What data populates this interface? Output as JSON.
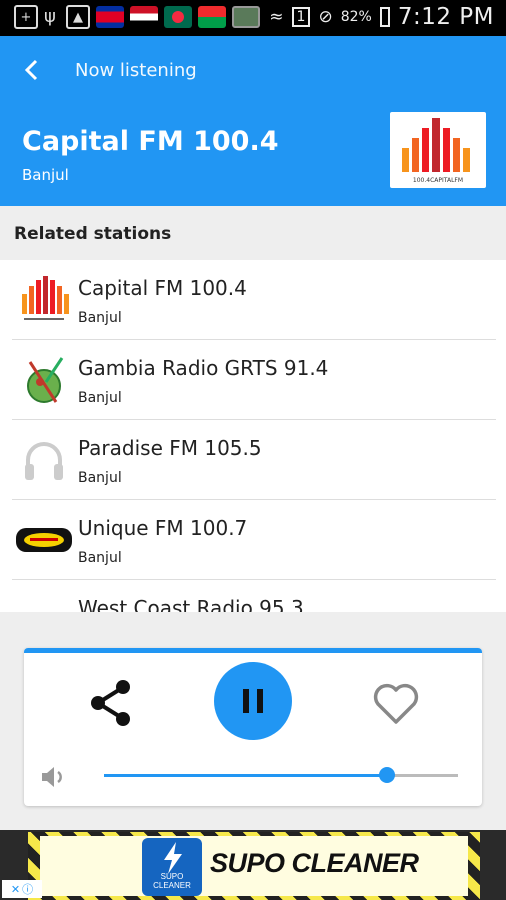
{
  "status_bar": {
    "battery": "82%",
    "time": "7:12 PM",
    "sim_badge": "1"
  },
  "app_bar": {
    "title": "Now listening",
    "station_name": "Capital FM 100.4",
    "station_city": "Banjul",
    "logo_text": "100.4CAPITALFM"
  },
  "section": {
    "title": "Related stations"
  },
  "stations": [
    {
      "name": "Capital FM 100.4",
      "city": "Banjul",
      "icon": "capital-fm-logo"
    },
    {
      "name": "Gambia Radio GRTS 91.4",
      "city": "Banjul",
      "icon": "grts-logo"
    },
    {
      "name": "Paradise FM 105.5",
      "city": "Banjul",
      "icon": "headphones-icon"
    },
    {
      "name": "Unique FM 100.7",
      "city": "Banjul",
      "icon": "unique-fm-logo"
    },
    {
      "name": "West Coast Radio 95.3",
      "city": "",
      "icon": ""
    }
  ],
  "player": {
    "state": "playing",
    "volume_fraction": 0.8
  },
  "ad": {
    "text": "SUPO CLEANER",
    "logo_text": "SUPO CLEANER"
  },
  "colors": {
    "primary": "#2196f3",
    "section_bg": "#eeeeee"
  }
}
